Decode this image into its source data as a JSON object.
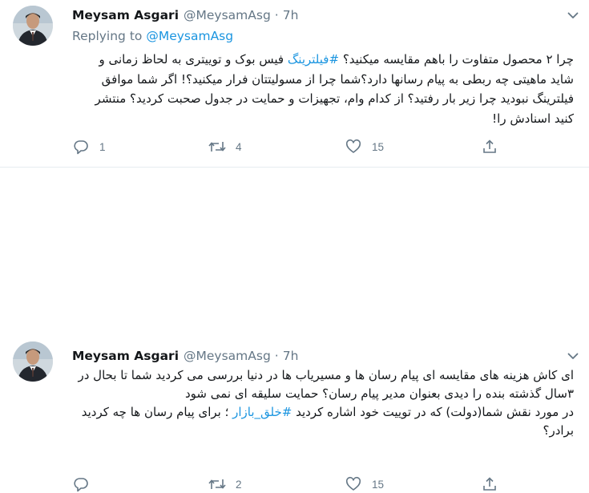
{
  "tweets": [
    {
      "author_name": "Meysam Asgari",
      "author_handle": "@MeysamAsg",
      "separator": "·",
      "time": "7h",
      "replying_label": "Replying to",
      "replying_to": "@MeysamAsg",
      "text_before_hashtag": "چرا ۲ محصول متفاوت را باهم مقایسه میکنید؟ ",
      "hashtag": "#فیلترینگ",
      "text_after_hashtag": " فیس بوک و توییتری به لحاظ زمانی و شاید ماهیتی چه ربطی به پیام رسانها دارد؟شما چرا از مسولیتتان فرار میکنید؟! اگر شما موافق فیلترینگ نبودید چرا زیر بار رفتید؟ از کدام وام، تجهیزات و حمایت در جدول صحبت کردید؟ منتشر کنید اسنادش را!",
      "reply_count": "1",
      "retweet_count": "4",
      "like_count": "15",
      "share_count": ""
    },
    {
      "author_name": "Meysam Asgari",
      "author_handle": "@MeysamAsg",
      "separator": "·",
      "time": "7h",
      "paragraph_1": "ای کاش هزینه های مقایسه ای پیام رسان ها و مسیریاب ها در دنیا بررسی می کردید شما تا بحال در ۳سال گذشته بنده را دیدی بعنوان مدیر پیام رسان؟ حمایت سلیقه ای نمی شود",
      "paragraph_2_before_hashtag": "در مورد نقش شما(دولت) که در توییت خود اشاره کردید ",
      "hashtag": "#خلق_بازار",
      "paragraph_2_after_hashtag": " ؛ برای پیام رسان ها چه کردید برادر؟",
      "reply_count": "",
      "retweet_count": "2",
      "like_count": "15",
      "share_count": ""
    }
  ],
  "icons": [
    "profile-avatar",
    "chevron-down-icon",
    "reply-icon",
    "retweet-icon",
    "like-icon",
    "share-icon"
  ],
  "colors": {
    "link": "#1b95e0",
    "text": "#14171a",
    "secondary": "#657786",
    "divider": "#e6ecf0"
  }
}
